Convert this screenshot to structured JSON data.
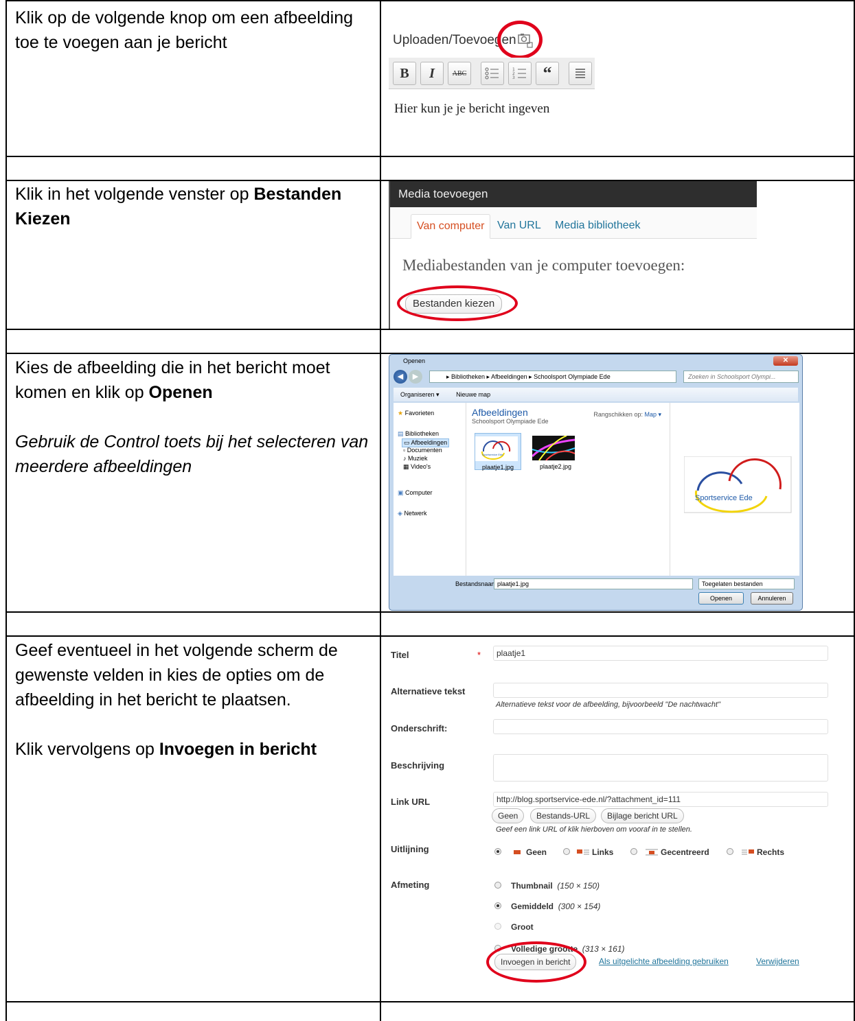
{
  "rows": [
    {
      "paragraphs": [
        [
          {
            "t": "Klik op de volgende knop om een afbeelding toe te voegen aan je bericht",
            "b": false,
            "i": false
          }
        ]
      ]
    },
    {
      "paragraphs": [
        [
          {
            "t": "Klik in het volgende venster op ",
            "b": false,
            "i": false
          },
          {
            "t": "Bestanden Kiezen",
            "b": true,
            "i": false
          }
        ]
      ]
    },
    {
      "paragraphs": [
        [
          {
            "t": "Kies de afbeelding die in het bericht moet komen en klik op ",
            "b": false,
            "i": false
          },
          {
            "t": "Openen",
            "b": true,
            "i": false
          }
        ],
        [
          {
            "t": "Gebruik de Control toets bij het selecteren van meerdere afbeeldingen",
            "b": false,
            "i": true
          }
        ]
      ]
    },
    {
      "paragraphs": [
        [
          {
            "t": "Geef eventueel in het volgende scherm de gewenste velden in kies de opties om de afbeelding in het bericht te plaatsen.",
            "b": false,
            "i": false
          }
        ],
        [
          {
            "t": "Klik vervolgens op ",
            "b": false,
            "i": false
          },
          {
            "t": "Invoegen in bericht",
            "b": true,
            "i": false
          }
        ]
      ]
    }
  ],
  "editor": {
    "upload_label": "Uploaden/Toevoegen",
    "body_text": "Hier kun je je bericht ingeven",
    "toolbar": [
      "B",
      "I",
      "ABC",
      "bullet-list-icon",
      "numbered-list-icon",
      "“",
      "align-icon"
    ]
  },
  "media_dialog": {
    "title": "Media toevoegen",
    "tabs": [
      "Van computer",
      "Van URL",
      "Media bibliotheek"
    ],
    "active_tab": "Van computer",
    "heading": "Mediabestanden van je computer toevoegen:",
    "choose_button": "Bestanden kiezen"
  },
  "open_dialog": {
    "title": "Openen",
    "breadcrumb": "▸ Bibliotheken ▸ Afbeeldingen ▸ Schoolsport Olympiade Ede",
    "search_placeholder": "Zoeken in Schoolsport Olympi...",
    "organize": "Organiseren ▾",
    "new_folder": "Nieuwe map",
    "nav": {
      "favorites": "Favorieten",
      "libraries": "Bibliotheken",
      "images": "Afbeeldingen",
      "documents": "Documenten",
      "music": "Muziek",
      "videos": "Video's",
      "computer": "Computer",
      "network": "Netwerk"
    },
    "library_title": "Afbeeldingen",
    "library_sub": "Schoolsport Olympiade Ede",
    "arrange_label": "Rangschikken op:",
    "arrange_value": "Map ▾",
    "files": [
      "plaatje1.jpg",
      "plaatje2.jpg"
    ],
    "thumb_caption": "Sportservice Ede",
    "preview_logo_text": "Sportservice Ede",
    "filename_label": "Bestandsnaam:",
    "filename_value": "plaatje1.jpg",
    "filter": "Toegelaten bestanden",
    "open_button": "Openen",
    "cancel_button": "Annuleren"
  },
  "form": {
    "title_label": "Titel",
    "required_mark": "*",
    "title_value": "plaatje1",
    "alt_label": "Alternatieve tekst",
    "alt_help": "Alternatieve tekst voor de afbeelding, bijvoorbeeld \"De nachtwacht\"",
    "caption_label": "Onderschrift:",
    "description_label": "Beschrijving",
    "link_label": "Link URL",
    "link_value": "http://blog.sportservice-ede.nl/?attachment_id=111",
    "link_buttons": [
      "Geen",
      "Bestands-URL",
      "Bijlage bericht URL"
    ],
    "link_help": "Geef een link URL of klik hierboven om vooraf in te stellen.",
    "align_label": "Uitlijning",
    "align_options": [
      "Geen",
      "Links",
      "Gecentreerd",
      "Rechts"
    ],
    "size_label": "Afmeting",
    "size_options": [
      {
        "name": "Thumbnail",
        "dim": "(150 × 150)"
      },
      {
        "name": "Gemiddeld",
        "dim": "(300 × 154)"
      },
      {
        "name": "Groot",
        "dim": ""
      },
      {
        "name": "Volledige grootte",
        "dim": "(313 × 161)"
      }
    ],
    "insert_button": "Invoegen in bericht",
    "featured_link": "Als uitgelichte afbeelding gebruiken",
    "delete_link": "Verwijderen"
  },
  "colors": {
    "highlight_circle": "#e0001b",
    "wp_link": "#21759b",
    "active_tab": "#d54e21"
  }
}
